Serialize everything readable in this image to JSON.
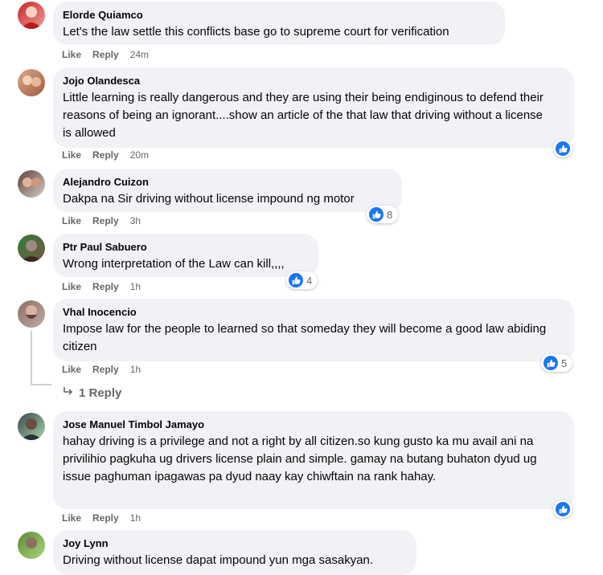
{
  "labels": {
    "like": "Like",
    "reply": "Reply"
  },
  "comments": [
    {
      "name": "Elorde Quiamco",
      "text": "Let's the law settle this conflicts base go to supreme court for verification",
      "time": "24m",
      "reactions": ""
    },
    {
      "name": "Jojo Olandesca",
      "text": "Little learning is really dangerous and they are using their being endiginous to defend their reasons of being an ignorant....show an article of the that law that driving without a license is allowed",
      "time": "20m",
      "reactions": ""
    },
    {
      "name": "Alejandro Cuizon",
      "text": "Dakpa na Sir driving without license impound ng motor",
      "time": "3h",
      "reactions": "8"
    },
    {
      "name": "Ptr Paul Sabuero",
      "text": "Wrong interpretation of the Law can kill,,,,",
      "time": "1h",
      "reactions": "4"
    },
    {
      "name": "Vhal Inocencio",
      "text": "Impose law for the people to learned so that someday they will become a good law abiding citizen",
      "time": "1h",
      "reactions": "5",
      "replies_label": "1 Reply"
    },
    {
      "name": "Jose Manuel Timbol Jamayo",
      "text": "hahay driving is a privilege and not a right by all citizen.so kung gusto ka mu avail ani na privilihio pagkuha ug drivers license plain and simple. gamay na butang buhaton dyud ug issue paghuman ipagawas pa dyud naay kay chiwftain na rank hahay.",
      "time": "1h",
      "reactions": ""
    },
    {
      "name": "Joy Lynn",
      "text": "Driving without license dapat impound yun mga sasakyan.",
      "time": "",
      "reactions": ""
    }
  ],
  "colors": {
    "bubble": "#f0f2f5",
    "like_blue": "#1877f2",
    "meta_gray": "#65676b"
  }
}
